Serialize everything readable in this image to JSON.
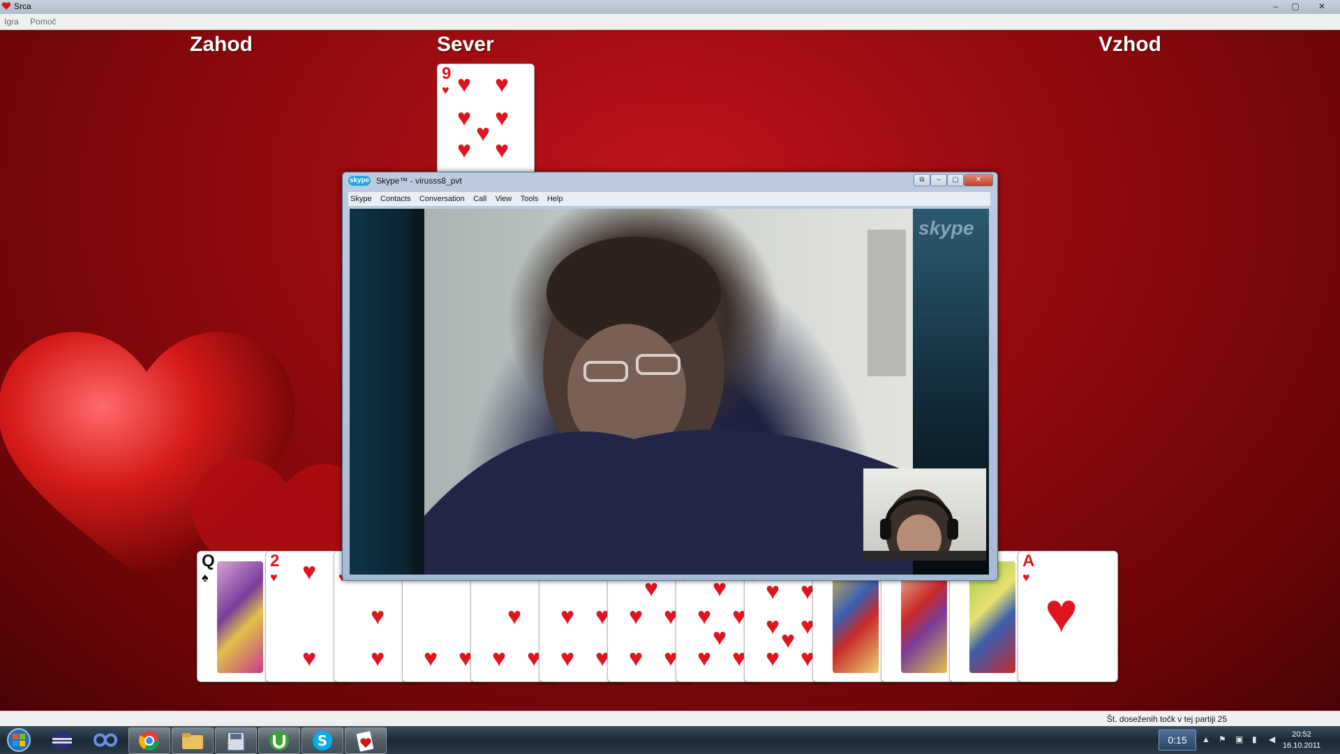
{
  "window": {
    "title": "Srca",
    "controls": [
      "–",
      "▢",
      "✕"
    ]
  },
  "menu": [
    "Igra",
    "Pomoč"
  ],
  "game": {
    "players": {
      "west": "Zahod",
      "north": "Sever",
      "east": "Vzhod"
    },
    "north_card": {
      "rank": "9",
      "suit": "♥"
    },
    "hand": [
      {
        "rank": "Q",
        "suit": "♠"
      },
      {
        "rank": "2",
        "suit": "♥"
      },
      {
        "rank": "",
        "suit": "♥"
      },
      {
        "rank": "",
        "suit": "♥"
      },
      {
        "rank": "",
        "suit": "♥"
      },
      {
        "rank": "",
        "suit": "♥"
      },
      {
        "rank": "",
        "suit": "♥"
      },
      {
        "rank": "",
        "suit": "♥"
      },
      {
        "rank": "",
        "suit": "♥"
      },
      {
        "rank": "",
        "suit": "♥"
      },
      {
        "rank": "",
        "suit": "♥"
      },
      {
        "rank": "",
        "suit": "♥"
      },
      {
        "rank": "A",
        "suit": "♥"
      }
    ]
  },
  "skype": {
    "logo": "skype",
    "title": "Skype™ - virusss8_pvt",
    "controls": [
      "⧉",
      "–",
      "▢",
      "✕"
    ],
    "menu": [
      "Skype",
      "Contacts",
      "Conversation",
      "Call",
      "View",
      "Tools",
      "Help"
    ],
    "watermark": "skype"
  },
  "status": {
    "text": "Št. doseženih točk v tej partiji 25"
  },
  "taskbar": {
    "timer": "0:15",
    "time": "20:52",
    "date": "16.10.2011",
    "apps": [
      "start",
      "eclipse",
      "infinity",
      "chrome",
      "explorer",
      "media",
      "utorrent",
      "skype",
      "hearts"
    ]
  }
}
